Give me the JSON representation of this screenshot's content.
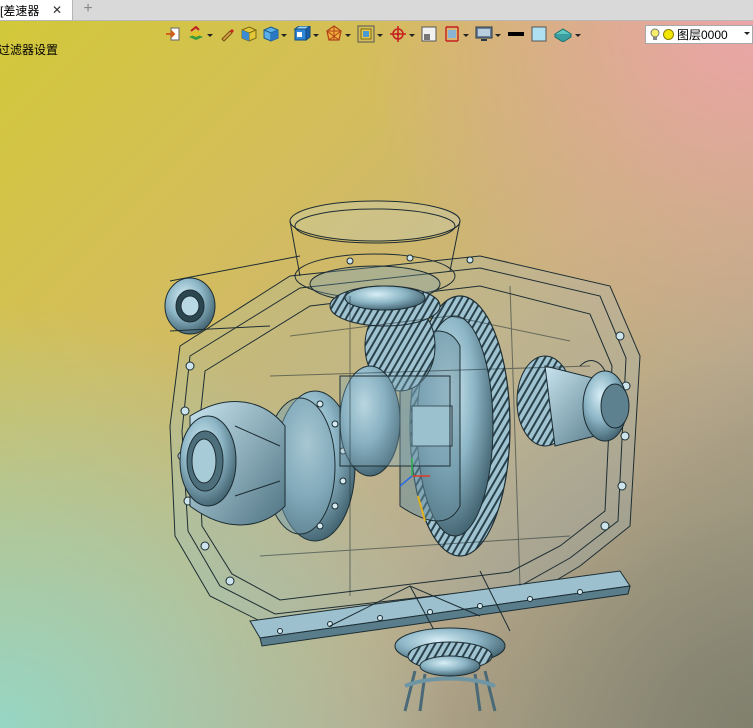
{
  "tab": {
    "title": "差速器]",
    "close_glyph": "✕",
    "new_tab_glyph": "+"
  },
  "status": {
    "message": "过滤器设置."
  },
  "toolbar": {
    "buttons": [
      {
        "icon": "import-icon",
        "dropdown": false
      },
      {
        "icon": "layers-stack-icon",
        "dropdown": true
      },
      {
        "icon": "pen-icon",
        "dropdown": false
      },
      {
        "icon": "yellow-cube-icon",
        "dropdown": false
      },
      {
        "icon": "blue-cube-icon",
        "dropdown": true
      },
      {
        "icon": "view-cube-icon",
        "dropdown": true
      },
      {
        "icon": "wireframe-sphere-icon",
        "dropdown": true
      },
      {
        "icon": "fit-view-icon",
        "dropdown": true
      },
      {
        "icon": "crosshair-icon",
        "dropdown": true
      },
      {
        "icon": "section-box-icon",
        "dropdown": false
      },
      {
        "icon": "measure-icon",
        "dropdown": true
      },
      {
        "icon": "display-monitor-icon",
        "dropdown": true
      },
      {
        "icon": "line-color-icon",
        "dropdown": false
      },
      {
        "icon": "fill-color-icon",
        "dropdown": false
      },
      {
        "icon": "material-icon",
        "dropdown": true
      }
    ],
    "colors": {
      "line": "#000000",
      "fill": "#aee0f2"
    }
  },
  "layer": {
    "label": "图层0000"
  },
  "model": {
    "color": "#7aa7b8",
    "edge_color": "#1d2d33"
  }
}
